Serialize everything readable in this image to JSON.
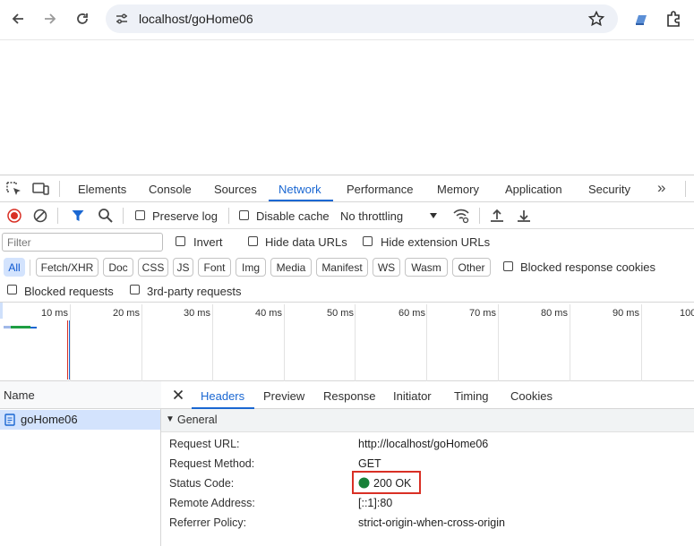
{
  "browser": {
    "url": "localhost/goHome06"
  },
  "devtools": {
    "tabs": [
      "Elements",
      "Console",
      "Sources",
      "Network",
      "Performance",
      "Memory",
      "Application",
      "Security"
    ],
    "active_tab": "Network",
    "more_tabs": "»"
  },
  "network_toolbar": {
    "preserve_log": "Preserve log",
    "disable_cache": "Disable cache",
    "throttling": "No throttling"
  },
  "filter_row": {
    "placeholder": "Filter",
    "invert": "Invert",
    "hide_data_urls": "Hide data URLs",
    "hide_extension_urls": "Hide extension URLs"
  },
  "type_filters": [
    "All",
    "Fetch/XHR",
    "Doc",
    "CSS",
    "JS",
    "Font",
    "Img",
    "Media",
    "Manifest",
    "WS",
    "Wasm",
    "Other"
  ],
  "blocked_response_cookies": "Blocked response cookies",
  "block_row": {
    "blocked_requests": "Blocked requests",
    "third_party": "3rd-party requests"
  },
  "timeline": {
    "ticks": [
      "10 ms",
      "20 ms",
      "30 ms",
      "40 ms",
      "50 ms",
      "60 ms",
      "70 ms",
      "80 ms",
      "90 ms",
      "100"
    ]
  },
  "requests": {
    "column_name": "Name",
    "rows": [
      {
        "name": "goHome06"
      }
    ]
  },
  "details": {
    "tabs": [
      "Headers",
      "Preview",
      "Response",
      "Initiator",
      "Timing",
      "Cookies"
    ],
    "active_tab": "Headers",
    "section": "General",
    "section_arrow": "▼",
    "fields": [
      {
        "key": "Request URL:",
        "value": "http://localhost/goHome06"
      },
      {
        "key": "Request Method:",
        "value": "GET"
      },
      {
        "key": "Status Code:",
        "value": "200 OK"
      },
      {
        "key": "Remote Address:",
        "value": "[::1]:80"
      },
      {
        "key": "Referrer Policy:",
        "value": "strict-origin-when-cross-origin"
      }
    ]
  },
  "colors": {
    "accent": "#1a67d2",
    "status_ok": "#188038",
    "highlight_box": "#d93025"
  }
}
